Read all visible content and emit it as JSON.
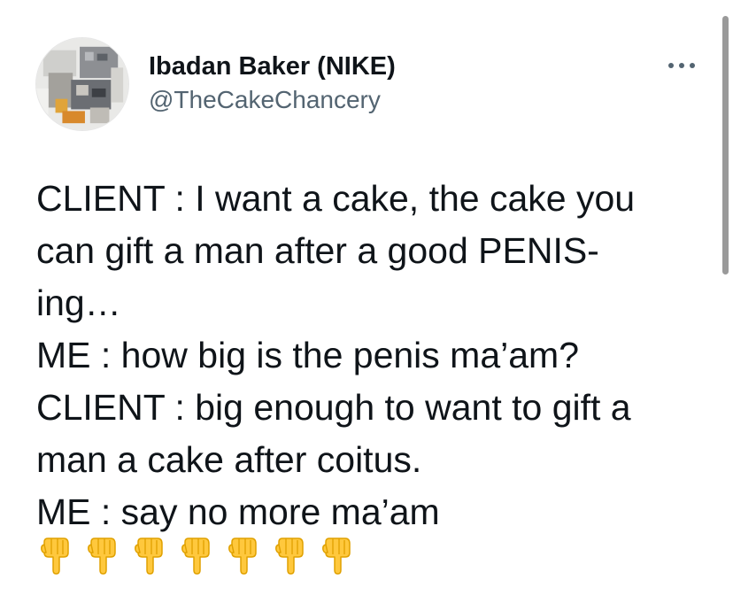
{
  "author": {
    "display_name": "Ibadan Baker (NIKE)",
    "handle": "@TheCakeChancery",
    "avatar_icon": "profile-photo-avatar"
  },
  "more_options_icon": "ellipsis-icon",
  "tweet": {
    "lines": [
      "CLIENT : I want a cake, the cake you",
      "can gift a man after a good PENIS-",
      "ing…",
      "ME : how big is the penis ma’am?",
      "CLIENT : big enough to want to gift a",
      "man a cake after coitus.",
      "ME : say no more ma’am"
    ],
    "emoji": [
      "👇",
      "👇",
      "👇",
      "👇",
      "👇",
      "👇",
      "👇"
    ],
    "emoji_icon": "backhand-index-pointing-down-icon"
  },
  "colors": {
    "text_primary": "#0f1419",
    "text_secondary": "#536471",
    "emoji_yellow": "#ffc83d"
  }
}
